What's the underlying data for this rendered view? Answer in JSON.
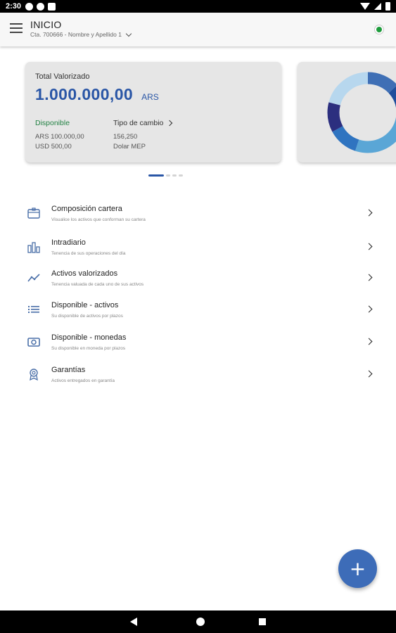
{
  "status_bar": {
    "time": "2:30",
    "left_icons": [
      "app-notification-icon",
      "game-notification-icon",
      "sd-card-icon"
    ],
    "right_icons": [
      "wifi-icon",
      "signal-icon",
      "battery-icon"
    ]
  },
  "app_bar": {
    "title": "INICIO",
    "account": "Cta. 700666 - Nombre y Apellido 1",
    "connection_status_color": "#1e9c3c"
  },
  "summary_card": {
    "total_label": "Total Valorizado",
    "total_value": "1.000.000,00",
    "total_currency": "ARS",
    "available_title": "Disponible",
    "available_ars": "ARS 100.000,00",
    "available_usd": "USD 500,00",
    "exchange_title": "Tipo de cambio",
    "exchange_value": "156,250",
    "exchange_desc": "Dolar MEP"
  },
  "chart_card": {
    "type": "donut",
    "segments": [
      {
        "color": "#3f6fb5",
        "fraction": 0.13
      },
      {
        "color": "#1f4e9c",
        "fraction": 0.12
      },
      {
        "color": "#5aa6d6",
        "fraction": 0.3
      },
      {
        "color": "#2f74c0",
        "fraction": 0.12
      },
      {
        "color": "#2c2f7f",
        "fraction": 0.12
      },
      {
        "color": "#b7d7ee",
        "fraction": 0.21
      }
    ]
  },
  "pager": {
    "pages": 4,
    "active": 0,
    "accent": "#2a56a6"
  },
  "menu": [
    {
      "icon": "wallet-icon",
      "title": "Composición cartera",
      "subtitle": "Visualice los activos que conforman su cartera"
    },
    {
      "icon": "bar-chart-icon",
      "title": "Intradiario",
      "subtitle": "Tenencia de sus operaciones del día"
    },
    {
      "icon": "trending-icon",
      "title": "Activos valorizados",
      "subtitle": "Tenencia valuada de cada uno de sus activos"
    },
    {
      "icon": "list-icon",
      "title": "Disponible - activos",
      "subtitle": "Su disponible de activos por plazos"
    },
    {
      "icon": "money-icon",
      "title": "Disponible - monedas",
      "subtitle": "Su disponible en moneda por plazos"
    },
    {
      "icon": "award-icon",
      "title": "Garantías",
      "subtitle": "Activos entregados en garantía"
    }
  ],
  "fab": {
    "label": "+",
    "color": "#3d6cb8"
  }
}
